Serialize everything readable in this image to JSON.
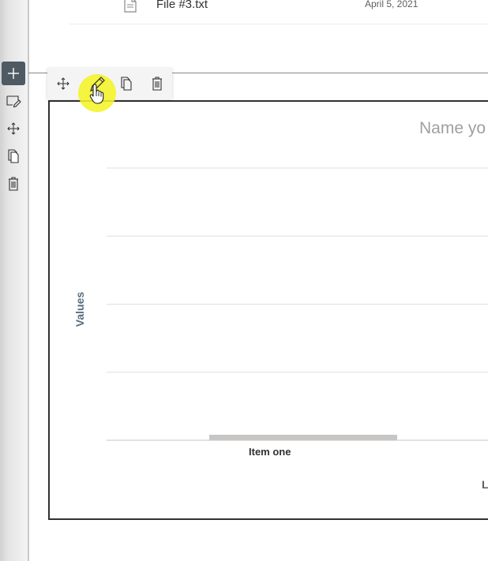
{
  "file_row": {
    "name": "File #3.txt",
    "date": "April 5, 2021"
  },
  "side_toolbar": {
    "buttons": [
      "add-section",
      "edit-section",
      "move-section",
      "duplicate-section",
      "delete-section"
    ]
  },
  "web_part_toolbar": {
    "buttons": [
      "move",
      "edit",
      "duplicate",
      "delete"
    ],
    "active": "edit"
  },
  "chart_data": {
    "type": "bar",
    "title": "Name yo",
    "ylabel": "Values",
    "categories": [
      "Item one"
    ],
    "values": [
      0
    ],
    "legend_partial": "L",
    "grid": true,
    "gridline_count": 4,
    "colors": {
      "bar": "#c8c6c4",
      "gridline": "#e1dfdd",
      "axis": "#c8c6c4"
    }
  },
  "colors": {
    "toolbar_active_bg": "#4f5a63",
    "click_highlight": "#f4f428",
    "frame_border": "#323130"
  }
}
